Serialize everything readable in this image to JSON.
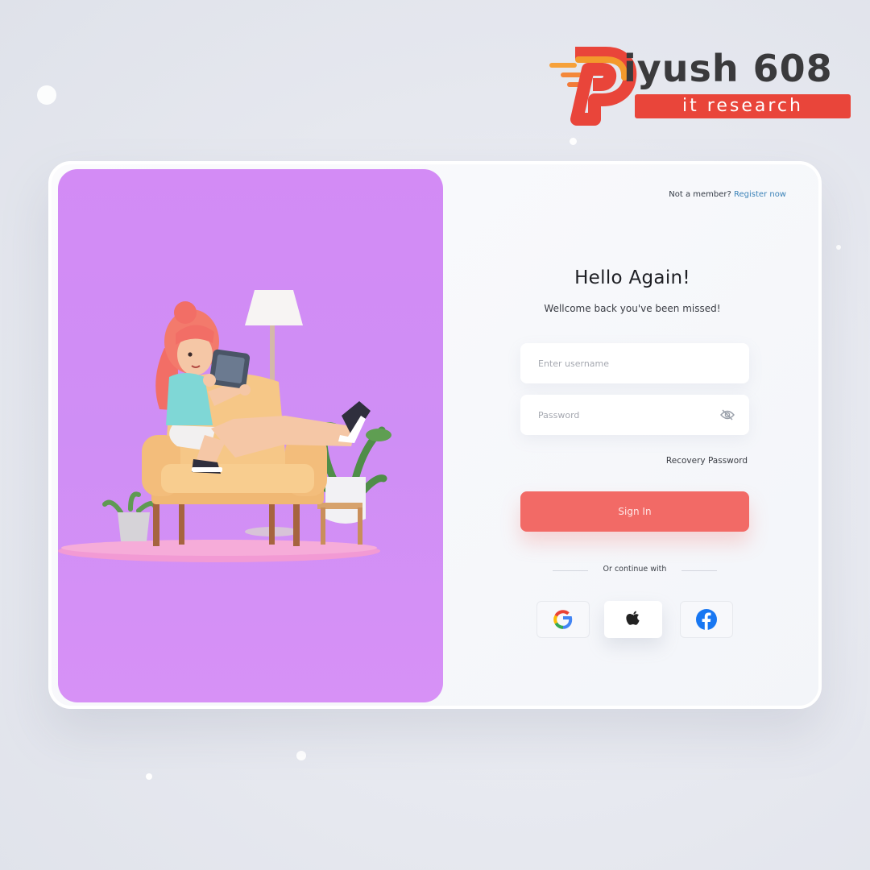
{
  "brand": {
    "wordmark": "iyush 608",
    "tagline": "it research",
    "accent_color": "#e9453a"
  },
  "header": {
    "register_prompt": "Not a member?",
    "register_link": "Register now"
  },
  "login": {
    "title": "Hello Again!",
    "subtitle": "Wellcome back you've been missed!",
    "username_placeholder": "Enter username",
    "password_placeholder": "Password",
    "password_toggle_icon": "eye-slash-icon",
    "recovery_label": "Recovery Password",
    "signin_label": "Sign In",
    "divider_text": "Or continue with"
  },
  "social": [
    {
      "provider": "Google",
      "icon": "google-icon"
    },
    {
      "provider": "Apple",
      "icon": "apple-icon"
    },
    {
      "provider": "Facebook",
      "icon": "facebook-icon"
    }
  ],
  "colors": {
    "hero_background": "#d38bf5",
    "signin_button": "#f26a66",
    "link": "#3b83b8"
  }
}
